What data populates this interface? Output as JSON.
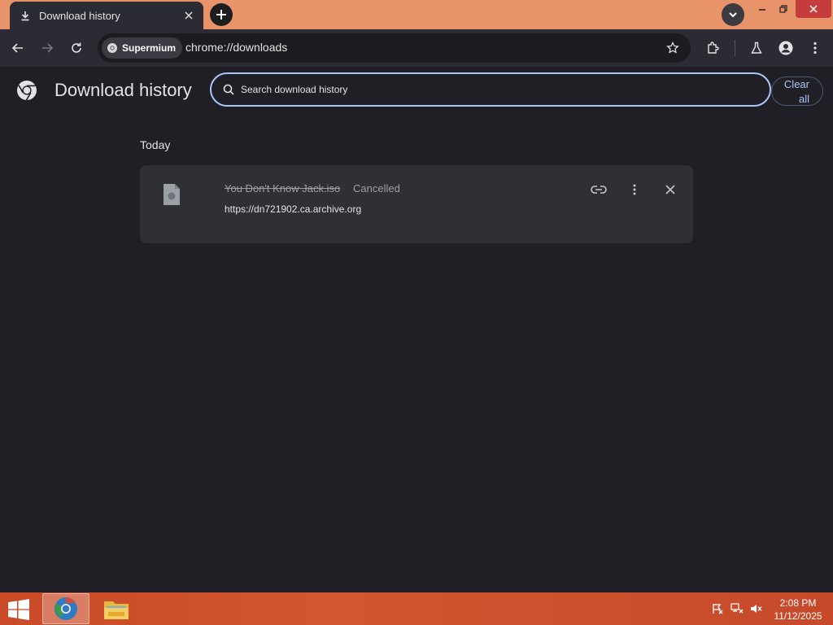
{
  "tab": {
    "title": "Download history"
  },
  "toolbar": {
    "site_chip": "Supermium",
    "url": "chrome://downloads"
  },
  "page": {
    "title": "Download history",
    "search_placeholder": "Search download history",
    "clear_all_line1": "Clear",
    "clear_all_line2": "all"
  },
  "downloads": {
    "date_header": "Today",
    "items": [
      {
        "filename": "You Don't Know Jack.iso",
        "status": "Cancelled",
        "url": "https://dn721902.ca.archive.org"
      }
    ]
  },
  "taskbar": {
    "time": "2:08 PM",
    "date": "11/12/2025"
  },
  "colors": {
    "tab_strip": "#e8936a",
    "toolbar": "#2b2b33",
    "page_bg": "#1f1f25",
    "card_bg": "#2f2f34",
    "accent": "#a8c7fa",
    "taskbar": "#c94a27"
  },
  "icons": {
    "tab": "download-icon",
    "file": "file-icon",
    "copy_link": "link-icon",
    "more": "more-vert-icon",
    "remove": "close-icon"
  }
}
